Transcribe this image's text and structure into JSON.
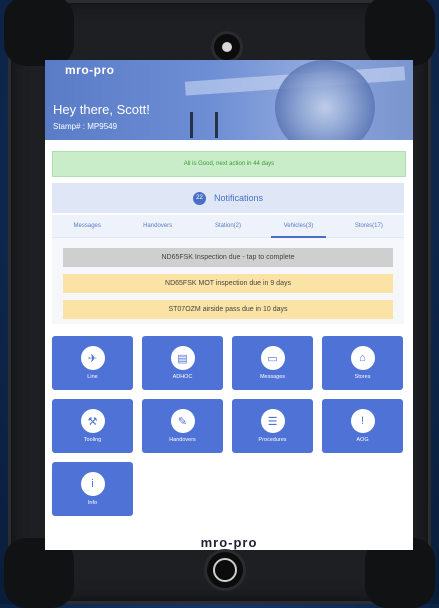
{
  "app": {
    "logo": "mro-pro",
    "footer_logo": "mro-pro"
  },
  "header": {
    "greeting": "Hey there, Scott!",
    "stamp": "Stamp# : MP9549"
  },
  "alert": {
    "text": "All is Good, next action in 44 days"
  },
  "notifications": {
    "count": "22",
    "title": "Notifications"
  },
  "tabs": [
    {
      "label": "Messages"
    },
    {
      "label": "Handovers"
    },
    {
      "label": "Station(2)"
    },
    {
      "label": "Vehicles(3)"
    },
    {
      "label": "Stores(17)"
    }
  ],
  "active_tab": "Vehicles(3)",
  "items": [
    {
      "text": "ND65FSK Inspection due - tap to complete",
      "status": "grey"
    },
    {
      "text": "ND65FSK MOT inspection due in 9 days",
      "status": "yellow"
    },
    {
      "text": "ST07OZM airside pass due in 10 days",
      "status": "yellow"
    }
  ],
  "tiles": [
    {
      "label": "Line",
      "icon": "airplane-icon"
    },
    {
      "label": "ADHOC",
      "icon": "clipboard-icon"
    },
    {
      "label": "Messages",
      "icon": "chat-icon"
    },
    {
      "label": "Stores",
      "icon": "warehouse-icon"
    },
    {
      "label": "Tooling",
      "icon": "wrench-icon"
    },
    {
      "label": "Handovers",
      "icon": "handover-doc-icon"
    },
    {
      "label": "Procedures",
      "icon": "checklist-icon"
    },
    {
      "label": "AOG",
      "icon": "alert-icon"
    },
    {
      "label": "Info",
      "icon": "info-icon"
    }
  ],
  "colors": {
    "header_blue": "#5a7cc7",
    "tile_blue": "#4f72d6",
    "alert_green_bg": "#c9edc8",
    "alert_green_text": "#3c9a3c",
    "item_grey": "#cfcfcf",
    "item_yellow": "#fbe3a6",
    "case": "#1e1f22"
  }
}
